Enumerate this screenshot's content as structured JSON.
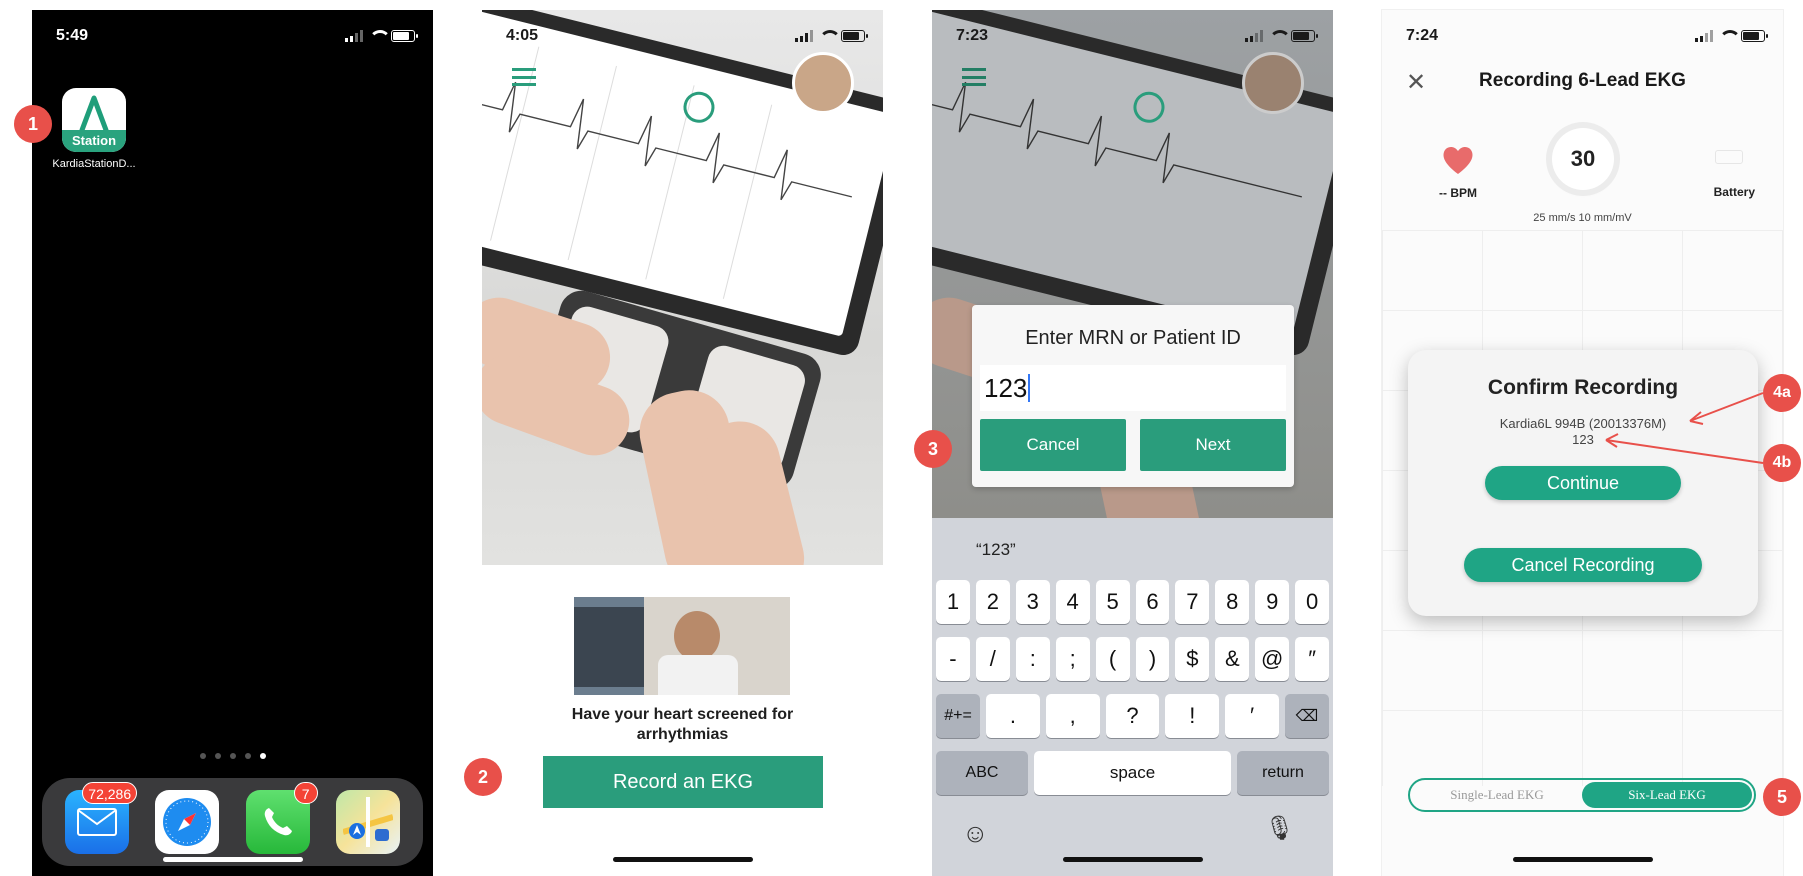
{
  "colors": {
    "accent": "#2a9d7c",
    "step_badge": "#e8504a",
    "notification_badge": "#f44336"
  },
  "screen1": {
    "time": "5:49",
    "app": {
      "icon_text": "Station",
      "label": "KardiaStationD..."
    },
    "dock": {
      "mail_badge": "72,286",
      "phone_badge": "7"
    }
  },
  "screen2": {
    "time": "4:05",
    "promo_text": "Have your heart screened for arrhythmias",
    "record_button": "Record an EKG"
  },
  "screen3": {
    "time": "7:23",
    "dialog": {
      "title": "Enter MRN or Patient ID",
      "value": "123",
      "cancel": "Cancel",
      "next": "Next"
    },
    "keyboard": {
      "suggestion": "“123”",
      "row1": [
        "1",
        "2",
        "3",
        "4",
        "5",
        "6",
        "7",
        "8",
        "9",
        "0"
      ],
      "row2": [
        "-",
        "/",
        ":",
        ";",
        "(",
        ")",
        "$",
        "&",
        "@",
        "″"
      ],
      "row3": [
        "#+=",
        ".",
        ",",
        "?",
        "!",
        "′",
        "⌫"
      ],
      "abc": "ABC",
      "space": "space",
      "return": "return"
    }
  },
  "screen4": {
    "time": "7:24",
    "title": "Recording 6-Lead EKG",
    "bpm": "-- BPM",
    "timer": "30",
    "battery": "Battery",
    "speeds": "25 mm/s  10 mm/mV",
    "confirm": {
      "title": "Confirm Recording",
      "device": "Kardia6L 994B (20013376M)",
      "patient_id": "123",
      "continue": "Continue",
      "cancel": "Cancel Recording"
    },
    "segment": {
      "single": "Single-Lead EKG",
      "six": "Six-Lead EKG"
    }
  },
  "steps": [
    "1",
    "2",
    "3",
    "4a",
    "4b",
    "5"
  ]
}
